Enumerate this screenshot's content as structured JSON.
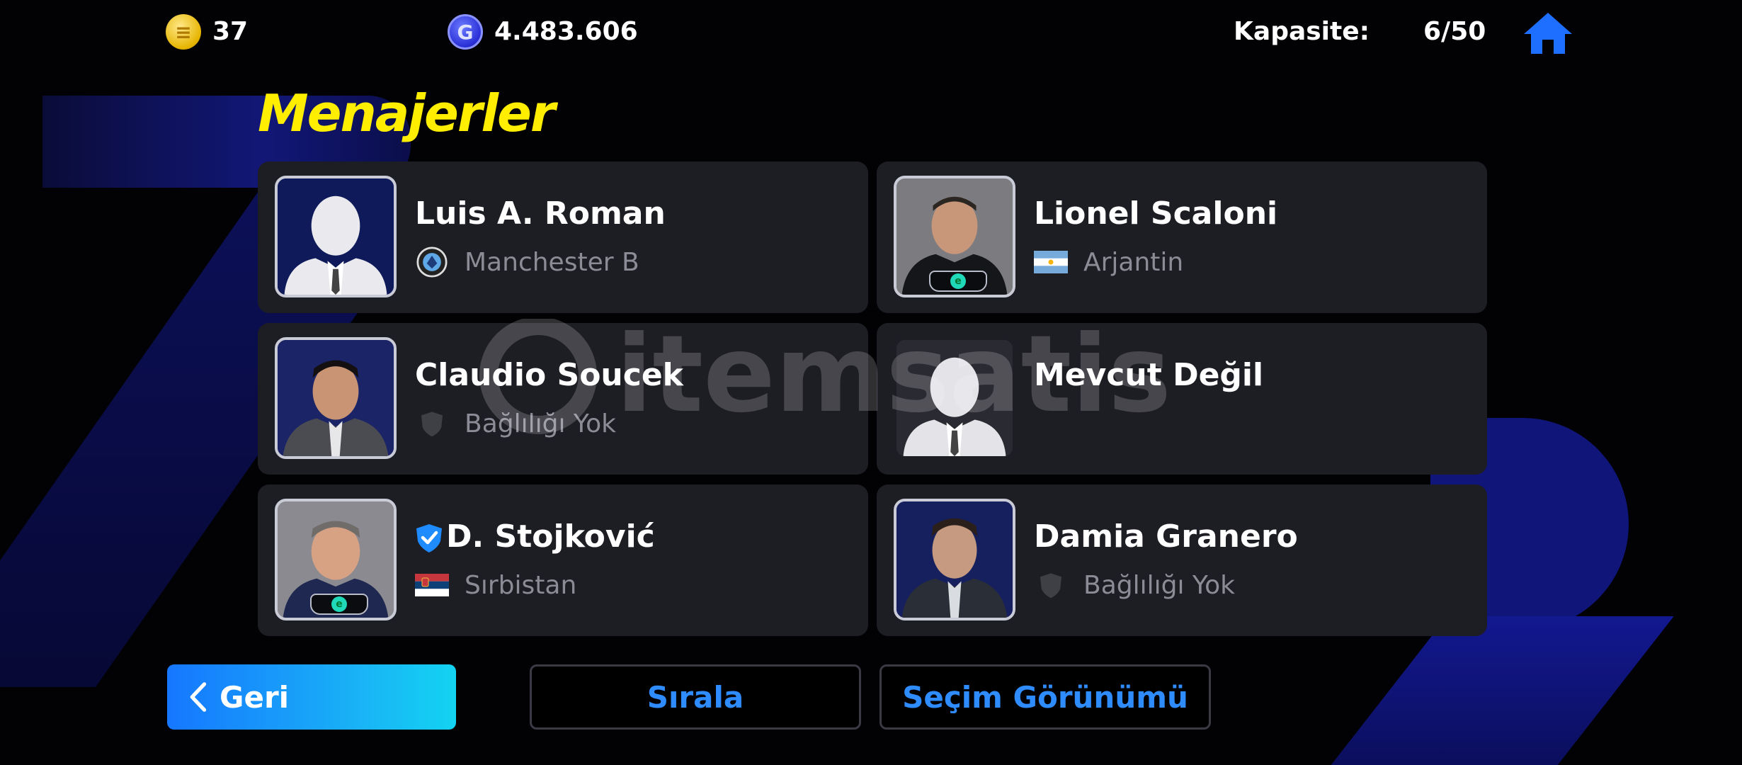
{
  "topbar": {
    "ecoin_icon": "efootball-coin-icon",
    "ecoin_value": "37",
    "gp_icon": "gp-coin-icon",
    "gp_value": "4.483.606",
    "capacity_label": "Kapasite:",
    "capacity_value": "6/50",
    "home_icon": "home-icon"
  },
  "title": "Menajerler",
  "managers": [
    {
      "name": "Luis A. Roman",
      "affiliation": "Manchester B",
      "affiliation_icon": "club-crest-icon",
      "portrait": "silhouette",
      "badge": false,
      "verified": false
    },
    {
      "name": "Lionel Scaloni",
      "affiliation": "Arjantin",
      "affiliation_icon": "argentina-flag-icon",
      "portrait": "photo",
      "badge": true,
      "verified": false
    },
    {
      "name": "Claudio Soucek",
      "affiliation": "Bağlılığı Yok",
      "affiliation_icon": "shield-icon",
      "portrait": "photo",
      "badge": false,
      "verified": false
    },
    {
      "name": "Mevcut Değil",
      "affiliation": "",
      "affiliation_icon": "",
      "portrait": "silhouette",
      "badge": false,
      "verified": false
    },
    {
      "name": "D. Stojković",
      "affiliation": "Sırbistan",
      "affiliation_icon": "serbia-flag-icon",
      "portrait": "photo",
      "badge": true,
      "verified": true
    },
    {
      "name": "Damia Granero",
      "affiliation": "Bağlılığı Yok",
      "affiliation_icon": "shield-icon",
      "portrait": "photo",
      "badge": false,
      "verified": false
    }
  ],
  "buttons": {
    "back_label": "Geri",
    "sort_label": "Sırala",
    "view_label": "Seçim Görünümü"
  },
  "colors": {
    "title": "#ffee00",
    "accent_blue": "#2f8cff",
    "card_bg": "#1d1d24",
    "sub_text": "#8c8c96"
  },
  "watermark": "itemsatis"
}
